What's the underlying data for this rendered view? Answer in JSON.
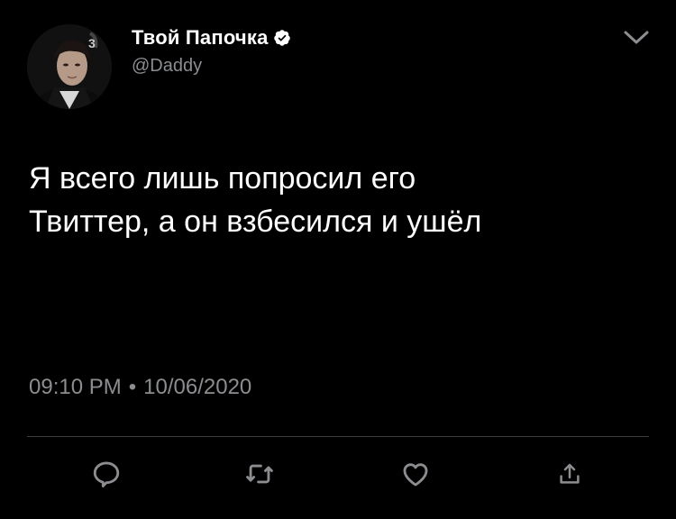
{
  "user": {
    "display_name": "Твой Папочка",
    "handle": "@Daddy",
    "verified": true
  },
  "tweet": {
    "text_lines": [
      "Я всего лишь попросил его",
      "Твиттер, а он взбесился и ушёл"
    ],
    "time": "09:10 PM",
    "separator": "•",
    "date": "10/06/2020"
  },
  "icons": {
    "menu": "chevron-down-icon",
    "verified": "verified-badge-icon",
    "reply": "reply-icon",
    "retweet": "retweet-icon",
    "like": "heart-icon",
    "share": "share-icon"
  },
  "colors": {
    "background": "#000000",
    "text": "#ffffff",
    "secondary_text": "#8b8d90",
    "icon": "#8b8d90",
    "divider": "#3a3c3e"
  }
}
